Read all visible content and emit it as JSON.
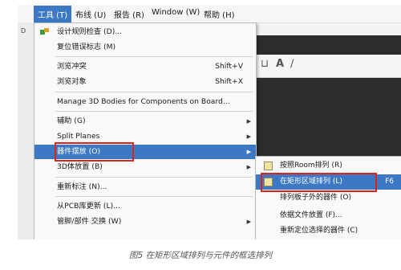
{
  "menubar": {
    "items": [
      "工具 (T)",
      "布线 (U)",
      "报告 (R)",
      "Window (W)",
      "帮助 (H)"
    ],
    "left_stub": "D"
  },
  "menu": {
    "items": [
      {
        "label": "设计规则检查 (D)...",
        "icon": "rule-check-icon"
      },
      {
        "label": "复位错误标志 (M)"
      },
      {
        "label": "浏览冲突",
        "shortcut": "Shift+V"
      },
      {
        "label": "浏览对象",
        "shortcut": "Shift+X"
      },
      {
        "label": "Manage 3D Bodies for Components on Board..."
      },
      {
        "label": "辅助 (G)",
        "submenu": true
      },
      {
        "label": "Split Planes",
        "submenu": true
      },
      {
        "label": "器件摆放 (O)",
        "submenu": true,
        "selected": true
      },
      {
        "label": "3D体放置 (B)",
        "submenu": true
      },
      {
        "label": "重新标注 (N)..."
      },
      {
        "label": "从PCB库更新 (L)..."
      },
      {
        "label": "管脚/部件 交换 (W)",
        "submenu": true
      }
    ]
  },
  "submenu": {
    "items": [
      {
        "label": "按照Room排列 (R)"
      },
      {
        "label": "在矩形区域排列 (L)",
        "shortcut": "F6",
        "selected": true
      },
      {
        "label": "排列板子外的器件 (O)"
      },
      {
        "label": "依据文件放置 (F)..."
      },
      {
        "label": "重新定位选择的器件 (C)"
      }
    ]
  },
  "caption": "图5 在矩形区域排列与元件的框选排列",
  "colors": {
    "highlight": "#3d78c4",
    "annotation_box": "#d9261c",
    "canvas": "#2c2c2c"
  }
}
